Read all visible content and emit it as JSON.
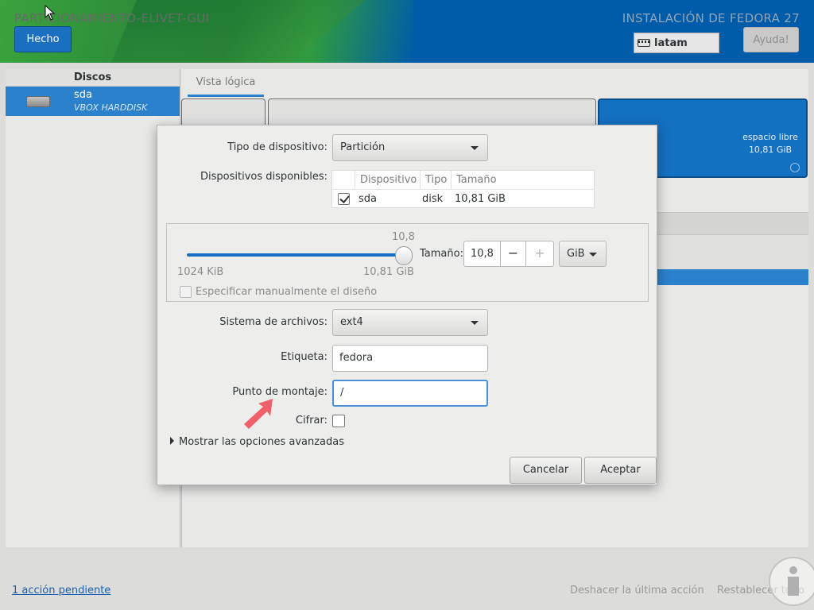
{
  "header": {
    "page_title": "PARTICIONAMIENTO-ELIVET-GUI",
    "done_label": "Hecho",
    "install_title": "INSTALACIÓN DE FEDORA 27",
    "keyboard_layout": "latam",
    "help_label": "Ayuda!"
  },
  "sidebar": {
    "header": "Discos",
    "disks": [
      {
        "name": "sda",
        "model": "VBOX HARDDISK"
      }
    ]
  },
  "main": {
    "tab_label": "Vista lógica",
    "free_space": {
      "label": "espacio libre",
      "size": "10,81 GiB"
    }
  },
  "dialog": {
    "device_type_label": "Tipo de dispositivo:",
    "device_type_value": "Partición",
    "available_devices_label": "Dispositivos disponibles:",
    "devices_table": {
      "columns": [
        "Dispositivo",
        "Tipo",
        "Tamaño"
      ],
      "rows": [
        {
          "checked": true,
          "device": "sda",
          "type": "disk",
          "size": "10,81 GiB"
        }
      ]
    },
    "slider": {
      "current": "10,8",
      "min_label": "1024 KiB",
      "max_label": "10,81 GiB",
      "fill_fraction": 1.0
    },
    "size_label": "Tamaño:",
    "size_value": "10,8",
    "size_minus": "−",
    "size_plus": "+",
    "size_unit": "GiB",
    "manual_layout_label": "Especificar manualmente el diseño",
    "filesystem_label": "Sistema de archivos:",
    "filesystem_value": "ext4",
    "label_label": "Etiqueta:",
    "label_value": "fedora",
    "mount_point_label": "Punto de montaje:",
    "mount_point_value": "/",
    "encrypt_label": "Cifrar:",
    "advanced_label": "Mostrar las opciones avanzadas",
    "cancel_label": "Cancelar",
    "accept_label": "Aceptar"
  },
  "footer": {
    "pending_label": "1 acción pendiente",
    "undo_label": "Deshacer la última acción",
    "reset_label": "Restablecer todo"
  },
  "colors": {
    "accent": "#2b81cc",
    "header_blue": "#005ca8",
    "annotation_arrow": "#f0606a"
  }
}
